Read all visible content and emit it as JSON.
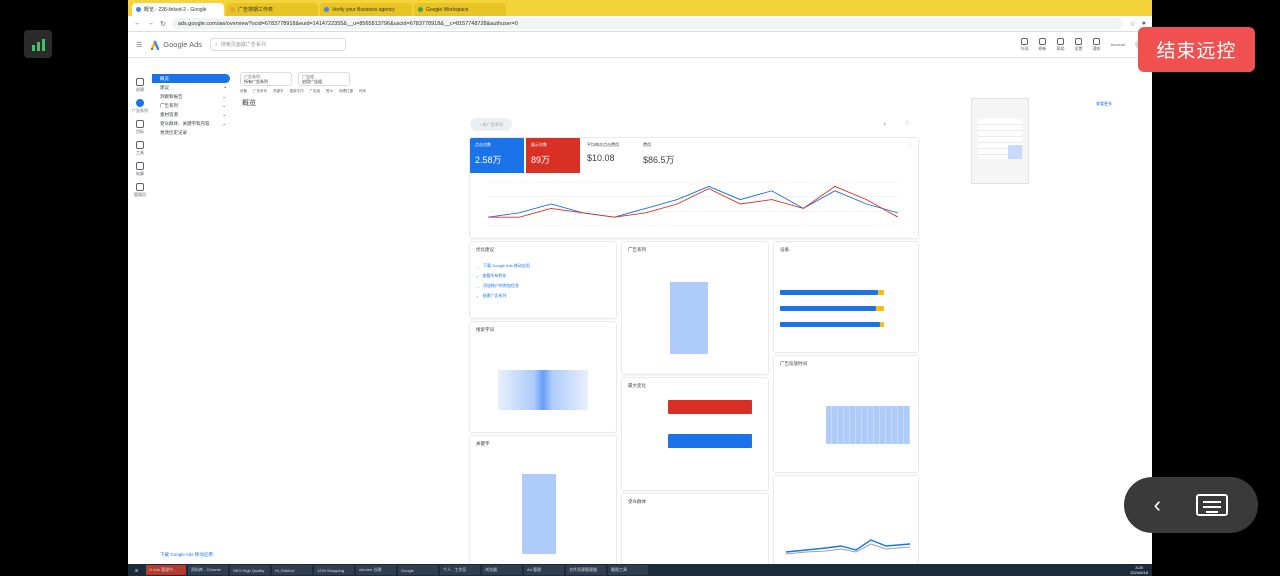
{
  "overlay": {
    "end_label": "结束远控"
  },
  "browser": {
    "tabs": [
      {
        "label": "概览 - 228-linked-2 - Google"
      },
      {
        "label": "广告排期工作表"
      },
      {
        "label": "Verify your Business agency"
      },
      {
        "label": "Google Workspace"
      }
    ],
    "url": "ads.google.com/aw/overview?ocid=6783778918&euid=1414722355&__u=8565813796&uscid=6783778918&__c=8157748728&authuser=0"
  },
  "ads": {
    "brand": "Google Ads",
    "search_placeholder": "搜索页面或广告系列",
    "header_icons": [
      "外观",
      "刷新",
      "帮助",
      "设置",
      "通知"
    ],
    "account": "Account",
    "filter1_label": "广告系列",
    "filter1_value": "所有广告系列",
    "filter2_label": "广告组",
    "filter2_value": "启用广告组",
    "page_title": "概览",
    "new_campaign": "+ 新广告系列",
    "right_link": "查看更多",
    "side_nav": [
      {
        "label": "概览",
        "active": true
      },
      {
        "label": "建议",
        "active": false
      },
      {
        "label": "洞察和报告",
        "active": false
      },
      {
        "label": "广告系列",
        "active": false
      },
      {
        "label": "素材资源",
        "active": false
      },
      {
        "label": "受众群体、关键字和内容",
        "active": false
      },
      {
        "label": "更改历史记录",
        "active": false
      }
    ],
    "rail": [
      "创建",
      "广告系列",
      "目标",
      "工具",
      "结算",
      "管理员"
    ],
    "sidebar_bottom": "下载 Google Ads 移动应用",
    "subtabs": [
      "设备",
      "广告系列",
      "关键字",
      "搜索字词",
      "广告组",
      "受众",
      "地理位置",
      "时间"
    ]
  },
  "kpis": [
    {
      "label": "点击次数",
      "value": "2.58万",
      "color": "#1a73e8"
    },
    {
      "label": "展示次数",
      "value": "89万",
      "color": "#d93025"
    },
    {
      "label": "平均每次点击费用",
      "value": "$10.08"
    },
    {
      "label": "费用",
      "value": "$86.5万"
    }
  ],
  "chart_data": {
    "type": "line",
    "series": [
      {
        "values": [
          0.2,
          0.3,
          0.5,
          0.3,
          0.2,
          0.4,
          0.6,
          0.9,
          0.6,
          0.8,
          0.4,
          0.8,
          0.5,
          0.3
        ]
      },
      {
        "values": [
          0.2,
          0.2,
          0.4,
          0.3,
          0.2,
          0.3,
          0.5,
          0.85,
          0.5,
          0.6,
          0.4,
          0.9,
          0.6,
          0.2
        ]
      }
    ]
  },
  "cards": {
    "recs": {
      "title": "优化建议",
      "items": [
        "下载 Google Ads 移动应用",
        "查看所有转化",
        "添加帐户的附加信息",
        "创建广告系列"
      ]
    },
    "kw": {
      "title": "搜索字词"
    },
    "devices": {
      "title": "设备"
    },
    "campaigns": {
      "title": "广告系列"
    },
    "changes": {
      "title": "最大变化"
    },
    "audiences": {
      "title": "受众群体"
    },
    "schedule": {
      "title": "广告投放时间"
    },
    "keywords": {
      "title": "关键字"
    }
  },
  "taskbar": {
    "items": [
      "G Ads 管理中...",
      "资料库 - Chrome",
      "SEO High Quality",
      "Hi_Roblox/",
      "1234 Shopping",
      "chrome 谷歌",
      "Google",
      "个人 - 工作区",
      "浏览器",
      "Ad 管理",
      "文件资源管理器",
      "截图工具",
      "开始"
    ],
    "time": "3:20",
    "date": "2024/6/18"
  }
}
